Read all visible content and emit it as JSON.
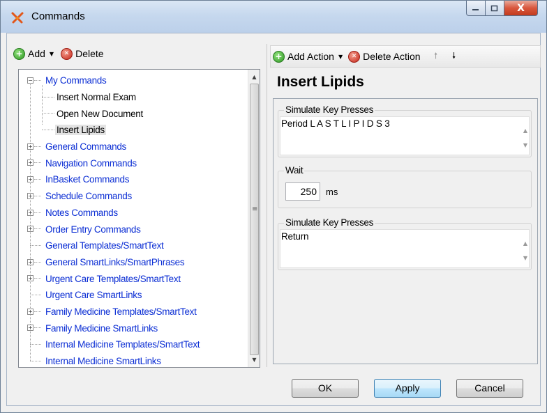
{
  "window": {
    "title": "Commands",
    "minimize_label": "–",
    "maximize_label": "□",
    "close_label": "X"
  },
  "left_toolbar": {
    "add_label": "Add",
    "delete_label": "Delete"
  },
  "tree": {
    "root": {
      "label": "My Commands",
      "expanded": true,
      "children": [
        {
          "label": "Insert Normal Exam"
        },
        {
          "label": "Open New Document"
        },
        {
          "label": "Insert Lipids",
          "selected": true
        }
      ]
    },
    "items": [
      {
        "label": "General Commands",
        "expandable": true
      },
      {
        "label": "Navigation Commands",
        "expandable": true
      },
      {
        "label": "InBasket Commands",
        "expandable": true
      },
      {
        "label": "Schedule Commands",
        "expandable": true
      },
      {
        "label": "Notes Commands",
        "expandable": true
      },
      {
        "label": "Order Entry Commands",
        "expandable": true
      },
      {
        "label": "General Templates/SmartText",
        "expandable": false
      },
      {
        "label": "General SmartLinks/SmartPhrases",
        "expandable": true
      },
      {
        "label": "Urgent Care Templates/SmartText",
        "expandable": true
      },
      {
        "label": "Urgent Care SmartLinks",
        "expandable": false
      },
      {
        "label": "Family Medicine Templates/SmartText",
        "expandable": true
      },
      {
        "label": "Family Medicine SmartLinks",
        "expandable": true
      },
      {
        "label": "Internal Medicine Templates/SmartText",
        "expandable": false
      },
      {
        "label": "Internal Medicine SmartLinks",
        "expandable": false
      }
    ]
  },
  "right_toolbar": {
    "add_action_label": "Add Action",
    "delete_action_label": "Delete Action"
  },
  "command": {
    "title": "Insert Lipids"
  },
  "actions": [
    {
      "type_label": "Simulate Key Presses",
      "value": "Period L A S T L I P I D S 3"
    },
    {
      "type_label": "Wait",
      "value": "250",
      "unit": "ms"
    },
    {
      "type_label": "Simulate Key Presses",
      "value": "Return"
    }
  ],
  "footer": {
    "ok_label": "OK",
    "apply_label": "Apply",
    "cancel_label": "Cancel"
  },
  "colors": {
    "tree_link": "#0b2ed4",
    "selected_bg": "#e3e3e3",
    "default_button_border": "#3c7fb1"
  }
}
